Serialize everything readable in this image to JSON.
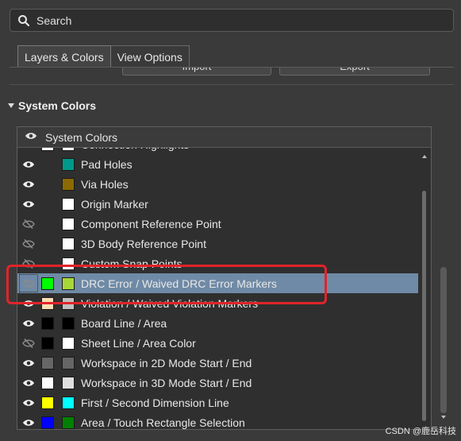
{
  "search": {
    "placeholder": "Search"
  },
  "tabs": [
    {
      "label": "Layers & Colors",
      "active": true
    },
    {
      "label": "View Options",
      "active": false
    }
  ],
  "buttons": {
    "import": "Import",
    "export": "Export"
  },
  "section": {
    "title": "System Colors",
    "expanded": true
  },
  "table": {
    "header": "System Colors",
    "rows": [
      {
        "label": "Connection Highlights",
        "visible": true,
        "colors": [
          "#ffffff",
          "#ffffff"
        ],
        "selected": false
      },
      {
        "label": "Pad Holes",
        "visible": true,
        "colors": [
          null,
          "#009a8a"
        ],
        "selected": false
      },
      {
        "label": "Via Holes",
        "visible": true,
        "colors": [
          null,
          "#8c6a00"
        ],
        "selected": false
      },
      {
        "label": "Origin Marker",
        "visible": true,
        "colors": [
          null,
          "#ffffff"
        ],
        "selected": false
      },
      {
        "label": "Component Reference Point",
        "visible": false,
        "colors": [
          null,
          "#ffffff"
        ],
        "selected": false
      },
      {
        "label": "3D Body Reference Point",
        "visible": false,
        "colors": [
          null,
          "#ffffff"
        ],
        "selected": false
      },
      {
        "label": "Custom Snap Points",
        "visible": false,
        "colors": [
          null,
          "#ffffff"
        ],
        "selected": false
      },
      {
        "label": "DRC Error / Waived DRC Error Markers",
        "visible": false,
        "colors": [
          "#00ff00",
          "#a8d838"
        ],
        "selected": true
      },
      {
        "label": "Violation / Waived Violation Markers",
        "visible": true,
        "colors": [
          "#f7deb4",
          "#c0c0c0"
        ],
        "selected": false
      },
      {
        "label": "Board Line / Area",
        "visible": true,
        "colors": [
          "#000000",
          "#000000"
        ],
        "selected": false
      },
      {
        "label": "Sheet Line / Area Color",
        "visible": false,
        "colors": [
          "#000000",
          "#ffffff"
        ],
        "selected": false
      },
      {
        "label": "Workspace in 2D Mode Start / End",
        "visible": true,
        "colors": [
          "#666666",
          "#666666"
        ],
        "selected": false
      },
      {
        "label": "Workspace in 3D Mode Start / End",
        "visible": true,
        "colors": [
          "#ffffff",
          "#e0e0e0"
        ],
        "selected": false
      },
      {
        "label": "First / Second Dimension Line",
        "visible": true,
        "colors": [
          "#ffff00",
          "#00ffff"
        ],
        "selected": false
      },
      {
        "label": "Area / Touch Rectangle Selection",
        "visible": true,
        "colors": [
          "#0000ff",
          "#008000"
        ],
        "selected": false
      }
    ]
  },
  "watermark": "CSDN @鹿岳科技",
  "colors": {
    "highlight": "#e0242a",
    "selection": "#6f8aa6"
  }
}
